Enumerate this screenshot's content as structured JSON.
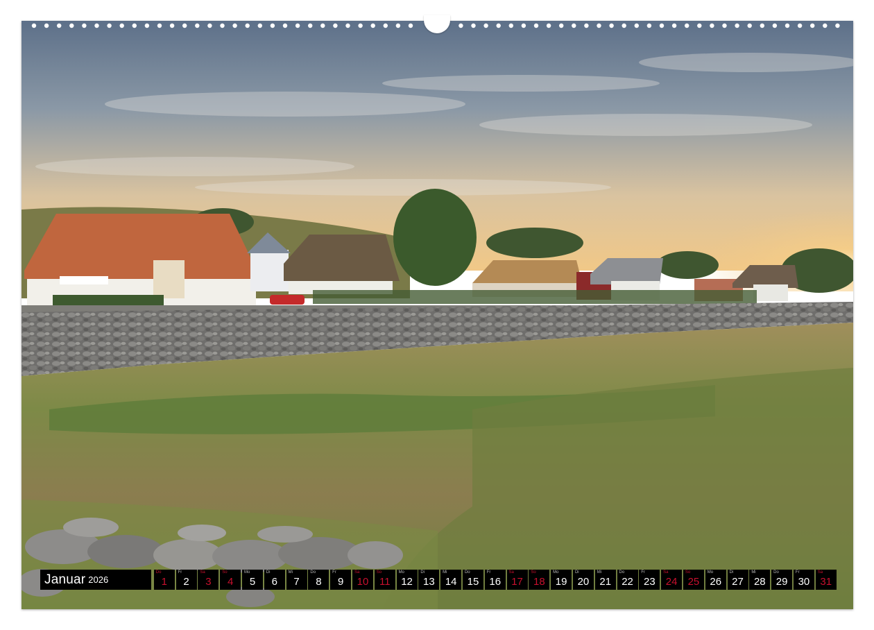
{
  "calendar": {
    "month": "Januar",
    "year": "2026",
    "days": [
      {
        "dow": "Do",
        "num": "1",
        "weekend": true
      },
      {
        "dow": "Fr",
        "num": "2",
        "weekend": false
      },
      {
        "dow": "Sa",
        "num": "3",
        "weekend": true
      },
      {
        "dow": "So",
        "num": "4",
        "weekend": true
      },
      {
        "dow": "Mo",
        "num": "5",
        "weekend": false
      },
      {
        "dow": "Di",
        "num": "6",
        "weekend": false
      },
      {
        "dow": "Mi",
        "num": "7",
        "weekend": false
      },
      {
        "dow": "Do",
        "num": "8",
        "weekend": false
      },
      {
        "dow": "Fr",
        "num": "9",
        "weekend": false
      },
      {
        "dow": "Sa",
        "num": "10",
        "weekend": true
      },
      {
        "dow": "So",
        "num": "11",
        "weekend": true
      },
      {
        "dow": "Mo",
        "num": "12",
        "weekend": false
      },
      {
        "dow": "Di",
        "num": "13",
        "weekend": false
      },
      {
        "dow": "Mi",
        "num": "14",
        "weekend": false
      },
      {
        "dow": "Do",
        "num": "15",
        "weekend": false
      },
      {
        "dow": "Fr",
        "num": "16",
        "weekend": false
      },
      {
        "dow": "Sa",
        "num": "17",
        "weekend": true
      },
      {
        "dow": "So",
        "num": "18",
        "weekend": true
      },
      {
        "dow": "Mo",
        "num": "19",
        "weekend": false
      },
      {
        "dow": "Di",
        "num": "20",
        "weekend": false
      },
      {
        "dow": "Mi",
        "num": "21",
        "weekend": false
      },
      {
        "dow": "Do",
        "num": "22",
        "weekend": false
      },
      {
        "dow": "Fr",
        "num": "23",
        "weekend": false
      },
      {
        "dow": "Sa",
        "num": "24",
        "weekend": true
      },
      {
        "dow": "So",
        "num": "25",
        "weekend": true
      },
      {
        "dow": "Mo",
        "num": "26",
        "weekend": false
      },
      {
        "dow": "Di",
        "num": "27",
        "weekend": false
      },
      {
        "dow": "Mi",
        "num": "28",
        "weekend": false
      },
      {
        "dow": "Do",
        "num": "29",
        "weekend": false
      },
      {
        "dow": "Fr",
        "num": "30",
        "weekend": false
      },
      {
        "dow": "Sa",
        "num": "31",
        "weekend": true
      }
    ]
  },
  "colors": {
    "strip_bg": "#000000",
    "weekday_text": "#ffffff",
    "weekend_text": "#c8102e",
    "sky_top": "#6a7d95",
    "sky_horizon": "#f3c27a",
    "grass": "#8a8a4a",
    "roof": "#c0663e"
  },
  "photo": {
    "subject": "village-landscape-photo"
  }
}
